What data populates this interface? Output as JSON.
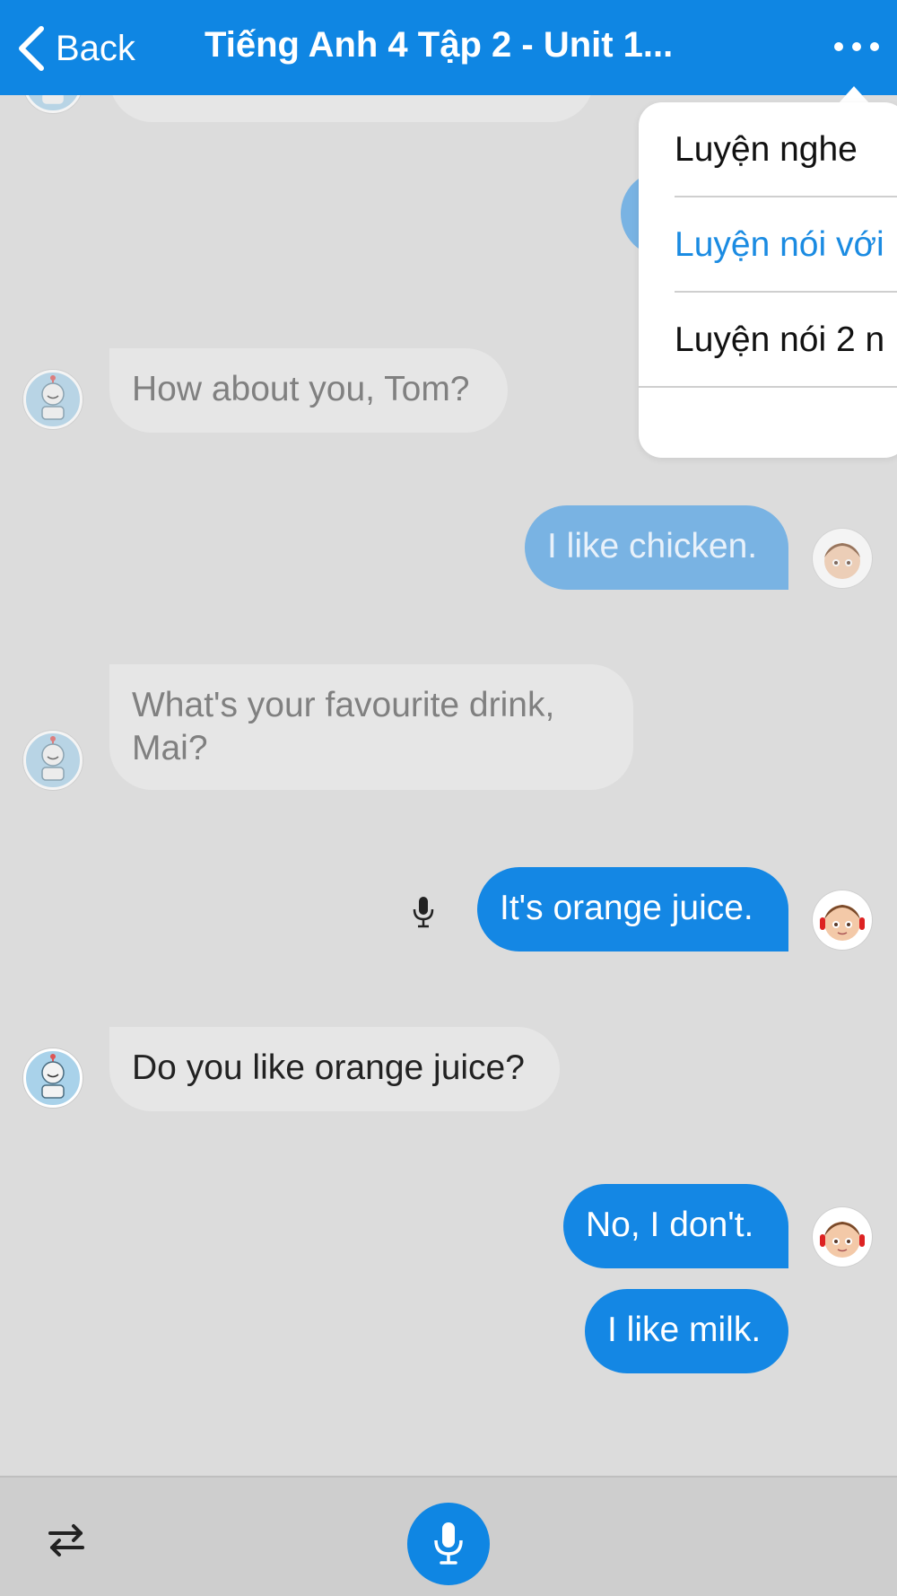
{
  "header": {
    "back_label": "Back",
    "title": "Tiếng Anh 4 Tập 2 - Unit 1..."
  },
  "menu": {
    "items": [
      {
        "label": "Luyện nghe",
        "selected": false
      },
      {
        "label": "Luyện nói với",
        "selected": true
      },
      {
        "label": "Luyện nói 2 n",
        "selected": false
      }
    ]
  },
  "messages": [
    {
      "from": "bot",
      "text": "How about you, Tom?",
      "state": "faded"
    },
    {
      "from": "user",
      "text": "I like chicken.",
      "state": "faded"
    },
    {
      "from": "bot",
      "text": "What's your favourite drink, Mai?",
      "state": "faded"
    },
    {
      "from": "user",
      "text": "It's orange juice.",
      "state": "active"
    },
    {
      "from": "bot",
      "text": "Do you like orange juice?",
      "state": "active"
    },
    {
      "from": "user",
      "text": "No, I don't.",
      "state": "active"
    },
    {
      "from": "user",
      "text": "I like milk.",
      "state": "active"
    }
  ],
  "colors": {
    "accent": "#0f86e3",
    "chat_background": "#dcdcdc",
    "bot_bubble": "#e6e6e6",
    "user_bubble": "#1487e4"
  },
  "icons": {
    "back": "chevron-left-icon",
    "more": "more-dots-icon",
    "swap": "swap-arrows-icon",
    "mic": "microphone-icon",
    "bot_avatar": "robot-avatar",
    "user_avatar": "boy-avatar"
  }
}
